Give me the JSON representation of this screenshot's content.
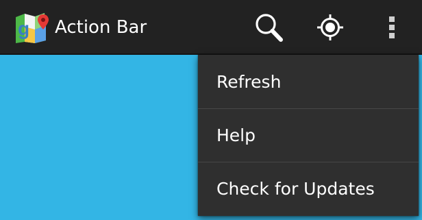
{
  "action_bar": {
    "title": "Action Bar",
    "background": "#222222",
    "app_icon": "maps-app-icon",
    "actions": [
      {
        "icon": "search-icon"
      },
      {
        "icon": "my-location-icon"
      },
      {
        "icon": "overflow-menu-icon"
      }
    ]
  },
  "content": {
    "background": "#33b5e5"
  },
  "overflow_menu": {
    "background": "#2f2f2f",
    "items": [
      {
        "label": "Refresh"
      },
      {
        "label": "Help"
      },
      {
        "label": "Check for Updates"
      }
    ]
  }
}
